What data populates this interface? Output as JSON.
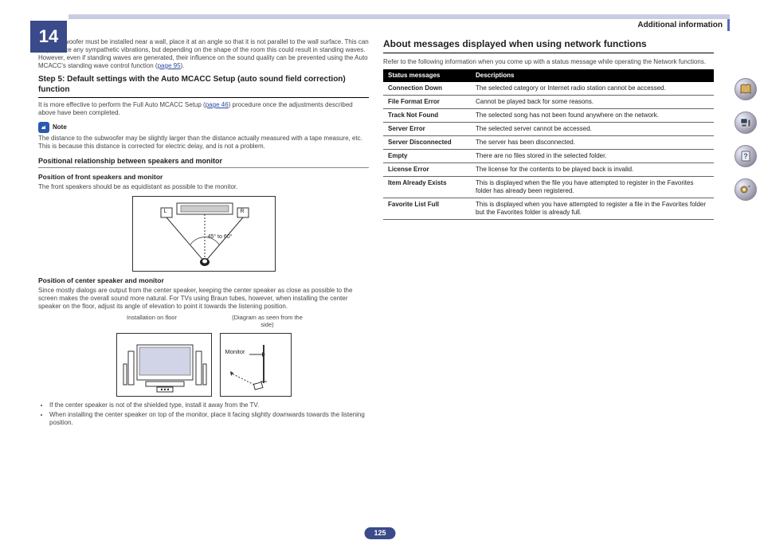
{
  "chapter": "14",
  "header": "Additional information",
  "page": "125",
  "left": {
    "intro": "If the subwoofer must be installed near a wall, place it at an angle so that it is not parallel to the wall surface. This can help reduce any sympathetic vibrations, but depending on the shape of the room this could result in standing waves. However, even if standing waves are generated, their influence on the sound quality can be prevented using the Auto MCACC's standing wave control function (",
    "intro_link": "page 95",
    "intro_close": ").",
    "step_title": "Step 5: Default settings with the Auto MCACC Setup (auto sound field correction) function",
    "step_body_a": "It is more effective to perform the Full Auto MCACC Setup (",
    "step_link": "page 46",
    "step_body_b": ") procedure once the adjustments described above have been completed.",
    "note_label": "Note",
    "note_body": "The distance to the subwoofer may be slightly larger than the distance actually measured with a tape measure, etc. This is because this distance is corrected for electric delay, and is not a problem.",
    "pos_title": "Positional relationship between speakers and monitor",
    "front_title": "Position of front speakers and monitor",
    "front_body": "The front speakers should be as equidistant as possible to the monitor.",
    "diag1_L": "L",
    "diag1_R": "R",
    "diag1_angle": "45° to 60°",
    "center_title": "Position of center speaker and monitor",
    "center_body": "Since mostly dialogs are output from the center speaker, keeping the center speaker as close as possible to the screen makes the overall sound more natural. For TVs using Braun tubes, however, when installing the center speaker on the floor, adjust its angle of elevation to point it towards the listening position.",
    "caption_a": "Installation on floor",
    "caption_b": "(Diagram as seen from the side)",
    "diag2_monitor": "Monitor",
    "bullets": [
      "If the center speaker is not of the shielded type, install it away from the TV.",
      "When installing the center speaker on top of the monitor, place it facing slightly downwards towards the listening position."
    ]
  },
  "right": {
    "title": "About messages displayed when using network functions",
    "lead": "Refer to the following information when you come up with a status message while operating the Network functions.",
    "th1": "Status messages",
    "th2": "Descriptions",
    "rows": [
      {
        "s": "Connection Down",
        "d": "The selected category or Internet radio station cannot be accessed."
      },
      {
        "s": "File Format Error",
        "d": "Cannot be played back for some reasons."
      },
      {
        "s": "Track Not Found",
        "d": "The selected song has not been found anywhere on the network."
      },
      {
        "s": "Server Error",
        "d": "The selected server cannot be accessed."
      },
      {
        "s": "Server Disconnected",
        "d": "The server has been disconnected."
      },
      {
        "s": "Empty",
        "d": "There are no files stored in the selected folder."
      },
      {
        "s": "License Error",
        "d": "The license for the contents to be played back is invalid."
      },
      {
        "s": "Item Already Exists",
        "d": "This is displayed when the file you have attempted to register in the Favorites folder has already been registered."
      },
      {
        "s": "Favorite List Full",
        "d": "This is displayed when you have attempted to register a file in the Favorites folder but the Favorites folder is already full."
      }
    ]
  },
  "nav_icons": [
    "book-icon",
    "system-icon",
    "help-icon",
    "settings-icon"
  ]
}
